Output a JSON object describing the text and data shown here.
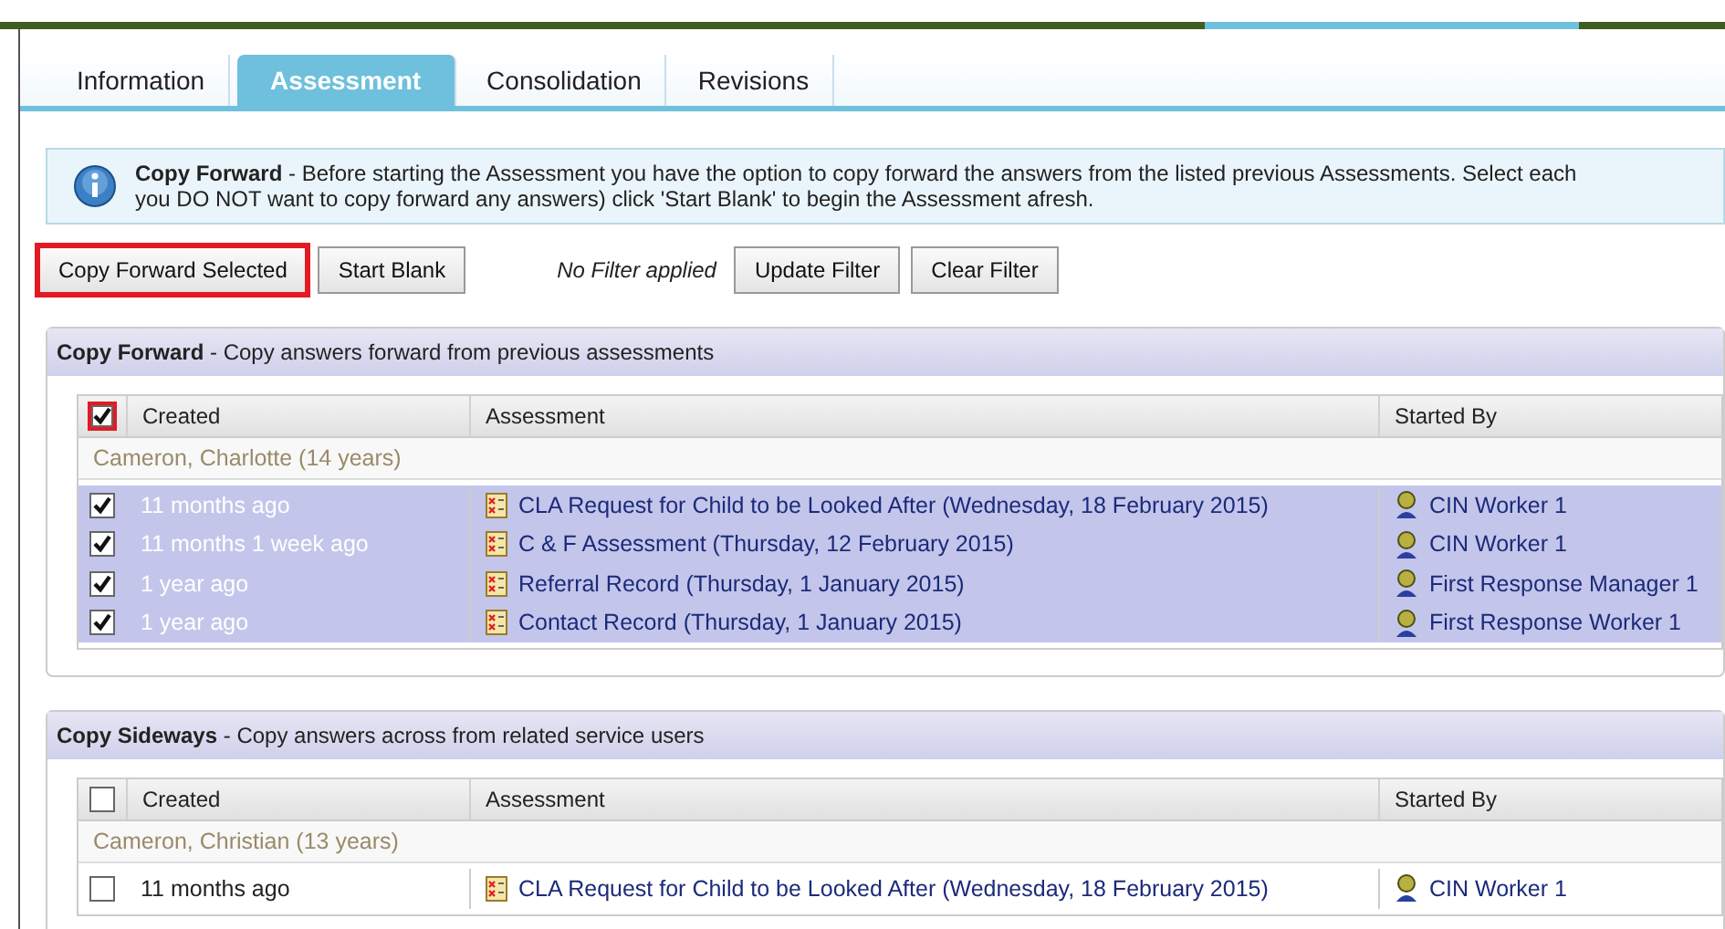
{
  "tabs": [
    {
      "label": "Information",
      "selected": false
    },
    {
      "label": "Assessment",
      "selected": true
    },
    {
      "label": "Consolidation",
      "selected": false
    },
    {
      "label": "Revisions",
      "selected": false
    }
  ],
  "info": {
    "title": "Copy Forward",
    "lines": [
      "- Before starting the Assessment you have the option to copy forward the answers from the listed previous Assessments. Select each",
      "you DO NOT want to copy forward any answers) click 'Start Blank' to begin the Assessment afresh."
    ]
  },
  "toolbar": {
    "buttons": [
      {
        "label": "Copy Forward Selected",
        "highlighted": true
      },
      {
        "label": "Start Blank",
        "highlighted": false
      }
    ],
    "filter_status": "No Filter applied",
    "filter_buttons": [
      "Update Filter",
      "Clear Filter"
    ]
  },
  "panels": [
    {
      "title": "Copy Forward",
      "subtitle": "- Copy answers forward from previous assessments",
      "select_all": {
        "checked": true,
        "highlighted": true
      },
      "columns": [
        "Created",
        "Assessment",
        "Started By"
      ],
      "group": "Cameron, Charlotte (14 years)",
      "rows": [
        {
          "checked": true,
          "selected": true,
          "created": "11 months ago",
          "assessment": "CLA Request for Child to be Looked After (Wednesday, 18 February 2015)",
          "started_by": "CIN Worker 1"
        },
        {
          "checked": true,
          "selected": true,
          "created": "11 months 1 week ago",
          "assessment": "C & F Assessment (Thursday, 12 February 2015)",
          "started_by": "CIN Worker 1"
        },
        {
          "checked": true,
          "selected": true,
          "created": "1 year ago",
          "assessment": "Referral Record (Thursday, 1 January 2015)",
          "started_by": "First Response Manager 1"
        },
        {
          "checked": true,
          "selected": true,
          "created": "1 year ago",
          "assessment": "Contact Record (Thursday, 1 January 2015)",
          "started_by": "First Response Worker 1"
        }
      ]
    },
    {
      "title": "Copy Sideways",
      "subtitle": "- Copy answers across from related service users",
      "select_all": {
        "checked": false,
        "highlighted": false
      },
      "columns": [
        "Created",
        "Assessment",
        "Started By"
      ],
      "group": "Cameron, Christian (13 years)",
      "rows": [
        {
          "checked": false,
          "selected": false,
          "created": "11 months ago",
          "assessment": "CLA Request for Child to be Looked After (Wednesday, 18 February 2015)",
          "started_by": "CIN Worker 1"
        }
      ]
    }
  ]
}
